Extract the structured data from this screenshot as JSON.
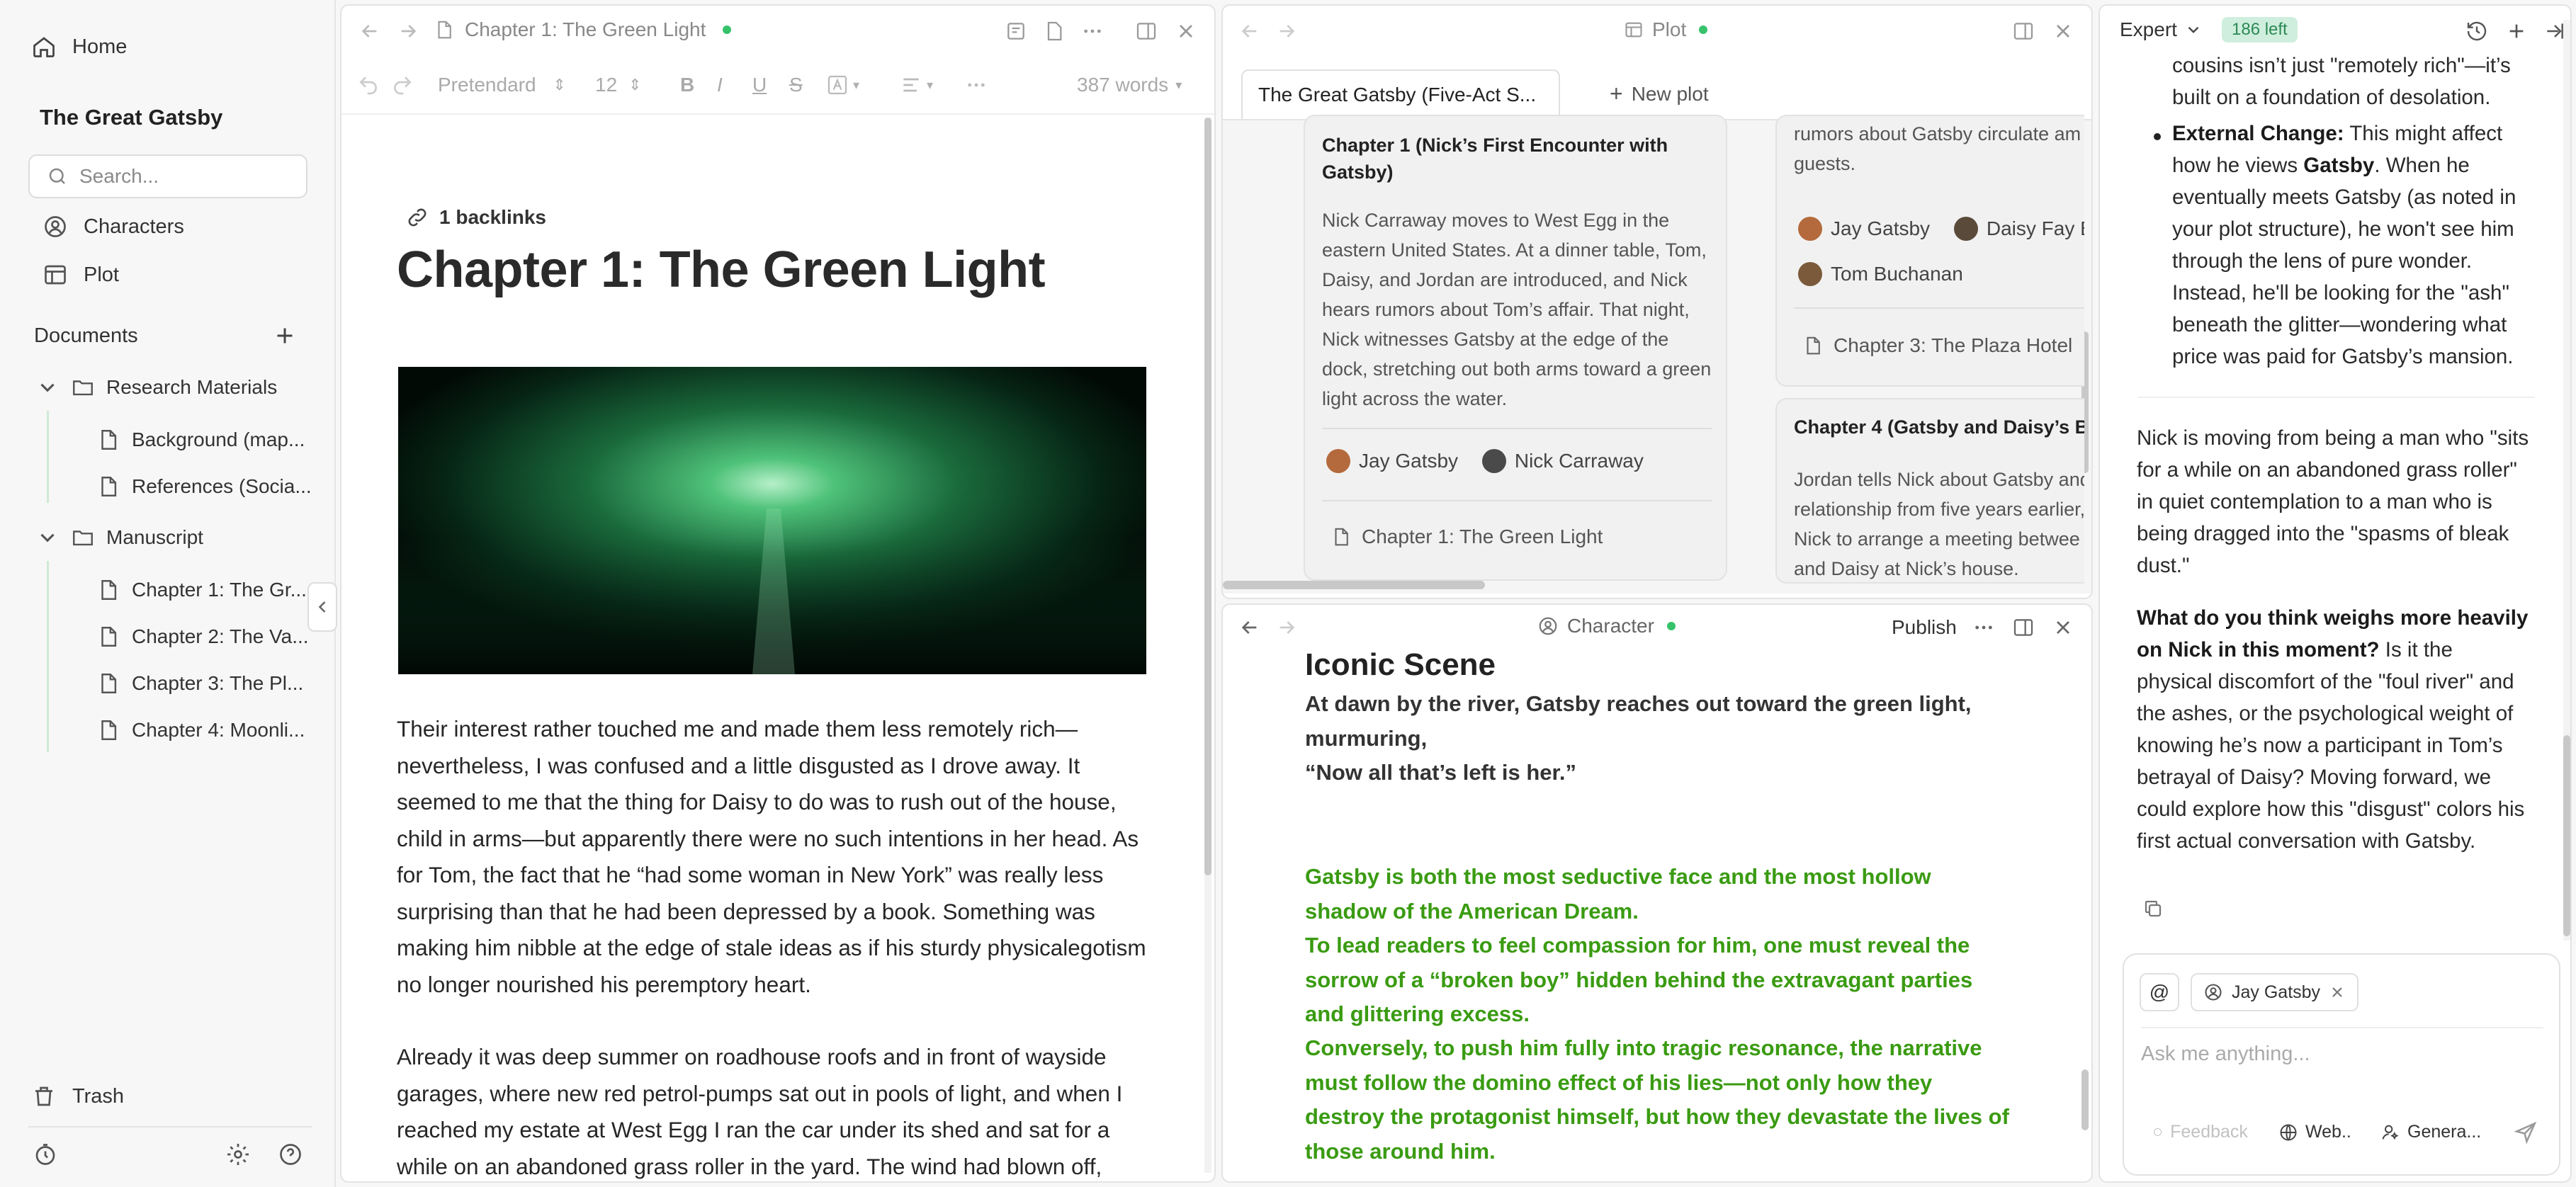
{
  "sidebar": {
    "home": "Home",
    "project_title": "The Great Gatsby",
    "search_placeholder": "Search...",
    "characters": "Characters",
    "plot": "Plot",
    "documents_label": "Documents",
    "folders": [
      {
        "name": "Research Materials",
        "items": [
          "Background (map...",
          "References (Socia..."
        ]
      },
      {
        "name": "Manuscript",
        "items": [
          "Chapter 1: The Gr...",
          "Chapter 2: The Va...",
          "Chapter 3: The Pl...",
          "Chapter 4: Moonli..."
        ]
      }
    ],
    "trash": "Trash"
  },
  "editor": {
    "tab_title": "Chapter 1: The Green Light",
    "font_name": "Pretendard",
    "font_size": "12",
    "word_count": "387 words",
    "backlinks": "1 backlinks",
    "heading": "Chapter 1: The Green Light",
    "paragraph1": "Their interest rather touched me and made them less remotely rich—nevertheless, I was confused and a little disgusted as I drove away. It seemed to me that the thing for Daisy to do was to rush out of the house, child in arms—but apparently there were no such intentions in her head. As for Tom, the fact that he “had some woman in New York” was really less surprising than that he had been depressed by a book. Something was making him nibble at the edge of stale ideas as if his sturdy physicalegotism no longer nourished his peremptory heart.",
    "paragraph2": "Already it was deep summer on roadhouse roofs and in front of wayside garages, where new red petrol-pumps sat out in pools of light, and when I reached my estate at West Egg I ran the car under its shed and sat for a while on an abandoned grass roller in the yard. The wind had blown off, leaving a loud, bright night, with wings beating in the trees and a"
  },
  "plot_panel": {
    "title": "Plot",
    "active_tab": "The Great Gatsby (Five-Act S...",
    "new_plot": "New plot",
    "card1": {
      "title": "Chapter 1 (Nick’s First Encounter with Gatsby)",
      "body": "Nick Carraway moves to West Egg in the eastern United States. At a dinner table, Tom, Daisy, and Jordan are introduced, and Nick hears rumors about Tom’s affair. That night, Nick witnesses Gatsby at the edge of the dock, stretching out both arms toward a green light across the water.",
      "chars": [
        "Jay Gatsby",
        "Nick Carraway"
      ],
      "doc": "Chapter 1: The Green Light"
    },
    "card2": {
      "body_top1": "rumors about Gatsby circulate am",
      "body_top2": "guests.",
      "chars_row1": [
        "Jay Gatsby",
        "Daisy Fay Bu"
      ],
      "chars_row2": [
        "Tom Buchanan"
      ],
      "doc": "Chapter 3: The Plaza Hotel"
    },
    "card3": {
      "title": "Chapter 4 (Gatsby and Daisy’s Ba",
      "body": [
        "Jordan tells Nick about Gatsby and",
        "relationship from five years earlier,",
        "Nick to arrange a meeting betwee",
        "and Daisy at Nick’s house."
      ]
    }
  },
  "character_panel": {
    "title": "Character",
    "publish": "Publish",
    "section_heading": "Iconic Scene",
    "line1": "At dawn by the river, Gatsby reaches out toward the green light, murmuring,",
    "line2": "“Now all that’s left is her.”",
    "green_paragraphs": [
      "Gatsby is both the most seductive face and the most hollow shadow of the American Dream.",
      "To lead readers to feel compassion for him, one must reveal the sorrow of a “broken boy” hidden behind the extravagant parties and glittering excess.",
      "Conversely, to push him fully into tragic resonance, the narrative must follow the domino effect of his lies—not only how they destroy the protagonist himself, but how they devastate the lives of those around him."
    ]
  },
  "chat": {
    "mode": "Expert",
    "quota": "186 left",
    "bullet1_tail": "cousins isn’t just \"remotely rich\"—it’s built on a foundation of desolation.",
    "bullet2_label": "External Change:",
    "bullet2_text_a": " This might affect how he views ",
    "bullet2_bold": "Gatsby",
    "bullet2_text_b": ". When he eventually meets Gatsby (as noted in your plot structure), he won't see him through the lens of pure wonder. Instead, he'll be looking for the \"ash\" beneath the glitter—wondering what price was paid for Gatsby’s mansion.",
    "para1": "Nick is moving from being a man who \"sits for a while on an abandoned grass roller\" in quiet contemplation to a man who is being dragged into the \"spasms of bleak dust.\"",
    "question_bold": "What do you think weighs more heavily on Nick in this moment?",
    "question_rest": " Is it the physical discomfort of the \"foul river\" and the ashes, or the psychological weight of knowing he’s now a participant in Tom’s betrayal of Daisy? Moving forward, we could explore how this \"disgust\" colors his first actual conversation with Gatsby.",
    "mention_chip": "Jay Gatsby",
    "input_placeholder": "Ask me anything...",
    "feedback": "Feedback",
    "web": "Web..",
    "generate": "Genera..."
  },
  "colors": {
    "accent_green": "#36c26b",
    "character_text_green": "#3a9b12"
  }
}
